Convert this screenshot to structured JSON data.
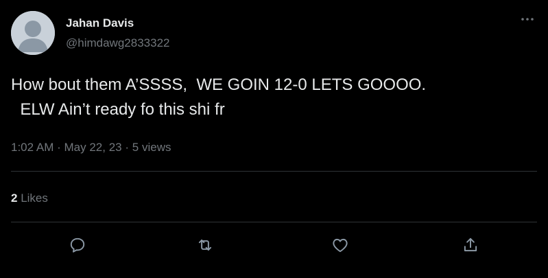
{
  "author": {
    "display_name": "Jahan Davis",
    "handle": "@himdawg2833322",
    "avatar_icon": "default-avatar-icon"
  },
  "tweet": {
    "text": "How bout them A’SSSS,  WE GOIN 12-0 LETS GOOOO.\n  ELW Ain’t ready fo this shi fr",
    "time": "1:02 AM",
    "date": "May 22, 23",
    "views_count": "5",
    "views_label": "views",
    "separator": "·"
  },
  "engagement": {
    "likes_count": "2",
    "likes_label": "Likes"
  },
  "actions": {
    "reply_icon": "reply-icon",
    "retweet_icon": "retweet-icon",
    "like_icon": "heart-icon",
    "share_icon": "share-icon",
    "more_icon": "more-options-icon"
  },
  "colors": {
    "background": "#000000",
    "primary_text": "#e7e9ea",
    "secondary_text": "#71767b",
    "divider": "#2f3336",
    "avatar_bg": "#c9d1d9",
    "avatar_fg": "#8b98a5"
  }
}
